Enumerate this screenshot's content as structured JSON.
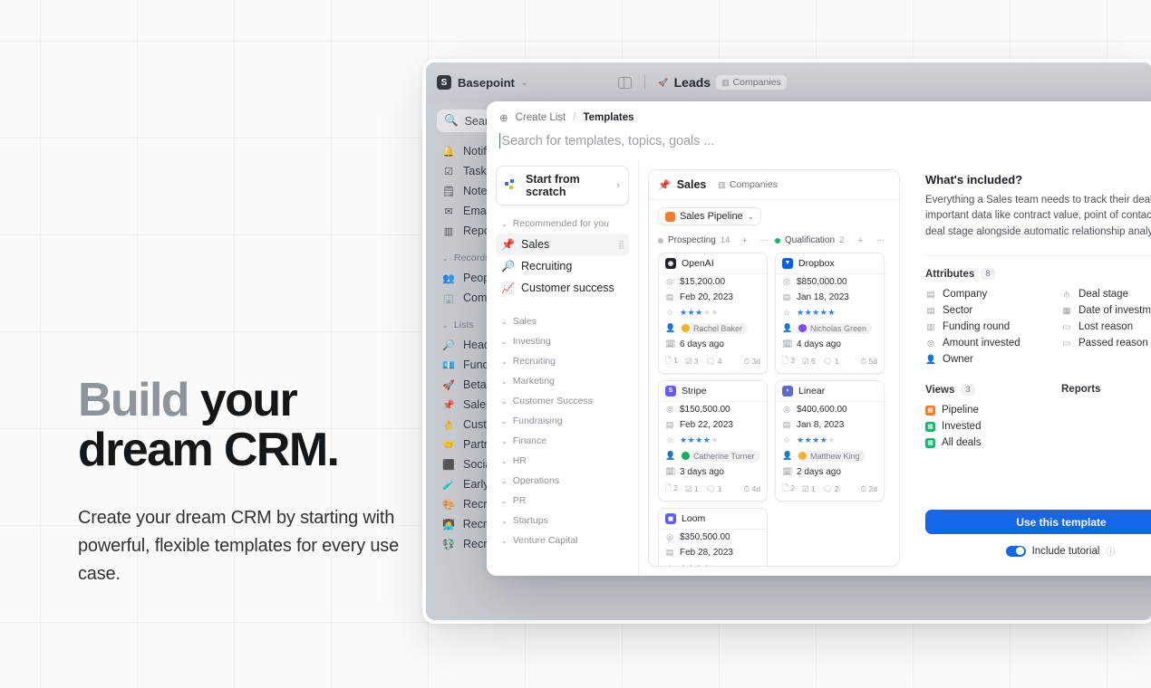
{
  "hero": {
    "title_muted": "Build",
    "title_rest": " your",
    "title_line2": "dream CRM.",
    "paragraph": "Create your dream CRM by starting with powerful, flexible templates for every use case."
  },
  "app": {
    "brand": {
      "mark": "S",
      "name": "Basepoint",
      "caret": "⌄"
    },
    "breadcrumb": {
      "icon": "🚀",
      "title": "Leads",
      "chip": "Companies",
      "chip_icon": "▥"
    },
    "sidebar": {
      "search_label": "Search",
      "primary": [
        {
          "icon": "🔔",
          "label": "Notifications"
        },
        {
          "icon": "☑",
          "label": "Tasks"
        },
        {
          "icon": "🗒",
          "label": "Notes"
        },
        {
          "icon": "✉",
          "label": "Emails"
        },
        {
          "icon": "▥",
          "label": "Reports"
        }
      ],
      "records_group": "Records",
      "records": [
        {
          "icon": "👥",
          "label": "People"
        },
        {
          "icon": "🏢",
          "label": "Companies"
        }
      ],
      "lists_group": "Lists",
      "lists": [
        {
          "icon": "🔎",
          "label": "Head of Talent"
        },
        {
          "icon": "💶",
          "label": "Fundraising"
        },
        {
          "icon": "🚀",
          "label": "Beta outreach"
        },
        {
          "icon": "📌",
          "label": "Sales"
        },
        {
          "icon": "👌",
          "label": "Customer success"
        },
        {
          "icon": "🤝",
          "label": "Partnerships"
        },
        {
          "icon": "⬛",
          "label": "Social Channels"
        },
        {
          "icon": "🧪",
          "label": "Early Access"
        },
        {
          "icon": "🎨",
          "label": "Recruiting"
        },
        {
          "icon": "👩‍💻",
          "label": "Recruiting - Engineering"
        },
        {
          "icon": "💱",
          "label": "Recruiting - Sales"
        }
      ]
    }
  },
  "modal": {
    "breadcrumb": {
      "icon": "⊕",
      "first": "Create List",
      "sep": "/",
      "current": "Templates"
    },
    "search_placeholder": "Search for templates, topics, goals ...",
    "scratch": {
      "label": "Start from scratch",
      "arrow": "›"
    },
    "recommended_group": "Recommended for you",
    "recommended": [
      {
        "emoji": "📌",
        "label": "Sales",
        "active": true
      },
      {
        "emoji": "🔎",
        "label": "Recruiting",
        "active": false
      },
      {
        "emoji": "📈",
        "label": "Customer success",
        "active": false
      }
    ],
    "categories": [
      "Sales",
      "Investing",
      "Recruiting",
      "Marketing",
      "Customer Success",
      "Fundraising",
      "Finance",
      "HR",
      "Operations",
      "PR",
      "Startups",
      "Venture Capital"
    ],
    "preview": {
      "emoji": "📌",
      "title": "Sales",
      "chip": "Companies",
      "view_pill": "Sales Pipeline",
      "view_pill_color": "#f07c2c",
      "columns": [
        {
          "name": "Prospecting",
          "count": "14",
          "dot_color": "#b9bec4",
          "cards": [
            {
              "name": "OpenAI",
              "logo_color": "#1f2329",
              "logo_letter": "◉",
              "amount": "$15,200.00",
              "date": "Feb 20, 2023",
              "stars_on": 3,
              "stars_off": 2,
              "owner": "Rachel Baker",
              "owner_color": "#f0b429",
              "updated": "6 days ago",
              "footer": [
                "1",
                "3",
                "4"
              ],
              "age": "3d"
            },
            {
              "name": "Stripe",
              "logo_color": "#635bff",
              "logo_letter": "S",
              "amount": "$150,500.00",
              "date": "Feb 22, 2023",
              "stars_on": 4,
              "stars_off": 1,
              "owner": "Catherine Turner",
              "owner_color": "#17ad5c",
              "updated": "3 days ago",
              "footer": [
                "2",
                "1",
                "1"
              ],
              "age": "4d"
            },
            {
              "name": "Loom",
              "logo_color": "#625df5",
              "logo_letter": "◼",
              "amount": "$350,500.00",
              "date": "Feb 28, 2023",
              "stars_on": 4,
              "stars_off": 1,
              "owner": "",
              "owner_color": "#625df5",
              "updated": "",
              "footer": [],
              "age": ""
            }
          ]
        },
        {
          "name": "Qualification",
          "count": "2",
          "dot_color": "#12b76a",
          "cards": [
            {
              "name": "Dropbox",
              "logo_color": "#0061fe",
              "logo_letter": "▼",
              "amount": "$850,000.00",
              "date": "Jan 18, 2023",
              "stars_on": 5,
              "stars_off": 0,
              "owner": "Nicholas Green",
              "owner_color": "#7a4df5",
              "updated": "4 days ago",
              "footer": [
                "3",
                "5",
                "1"
              ],
              "age": "5d"
            },
            {
              "name": "Linear",
              "logo_color": "#5e6ad2",
              "logo_letter": "◗",
              "amount": "$400,600.00",
              "date": "Jan 8, 2023",
              "stars_on": 4,
              "stars_off": 1,
              "owner": "Matthew King",
              "owner_color": "#f0b429",
              "updated": "2 days ago",
              "footer": [
                "2",
                "1",
                "2"
              ],
              "age": "2d"
            }
          ]
        }
      ]
    },
    "info": {
      "title": "What's included?",
      "description": "Everything a Sales team needs to track their deals. Record important data like contract value, point of contact, and deal stage alongside automatic relationship analytics.",
      "attributes_label": "Attributes",
      "attributes_count": "8",
      "attributes_left": [
        {
          "icon": "▤",
          "label": "Company"
        },
        {
          "icon": "▤",
          "label": "Sector"
        },
        {
          "icon": "▥",
          "label": "Funding round"
        },
        {
          "icon": "◎",
          "label": "Amount invested"
        },
        {
          "icon": "👤",
          "label": "Owner"
        }
      ],
      "attributes_right": [
        {
          "icon": "⫛",
          "label": "Deal stage"
        },
        {
          "icon": "▦",
          "label": "Date of investment"
        },
        {
          "icon": "▭",
          "label": "Lost reason"
        },
        {
          "icon": "▭",
          "label": "Passed reason"
        }
      ],
      "views_label": "Views",
      "views_count": "3",
      "views": [
        {
          "label": "Pipeline",
          "color": "#f07c2c"
        },
        {
          "label": "Invested",
          "color": "#12b76a"
        },
        {
          "label": "All deals",
          "color": "#12b76a"
        }
      ],
      "reports_label": "Reports",
      "cta_label": "Use this template",
      "toggle_label": "Include tutorial",
      "toggle_hint": "?",
      "accent_color": "#1567e8"
    }
  }
}
